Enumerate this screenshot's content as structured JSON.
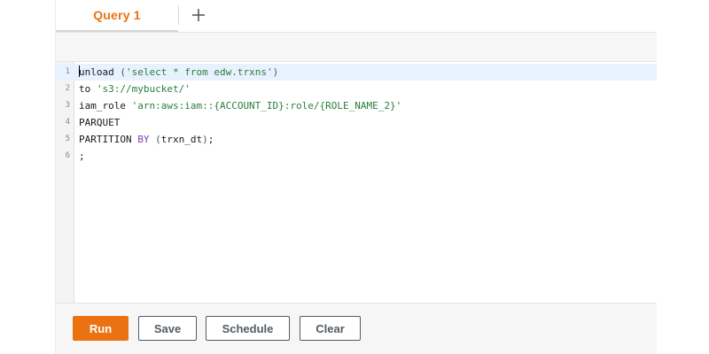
{
  "tabs": {
    "active": "Query 1",
    "add_symbol": "+"
  },
  "editor": {
    "lines": [
      {
        "num": "1",
        "tokens": [
          {
            "t": "unload",
            "c": "plain"
          },
          {
            "t": " ",
            "c": "plain"
          },
          {
            "t": "(",
            "c": "punc"
          },
          {
            "t": "'select * from edw.trxns'",
            "c": "str"
          },
          {
            "t": ")",
            "c": "punc"
          }
        ]
      },
      {
        "num": "2",
        "tokens": [
          {
            "t": "to ",
            "c": "plain"
          },
          {
            "t": "'s3://mybucket/'",
            "c": "str"
          }
        ]
      },
      {
        "num": "3",
        "tokens": [
          {
            "t": "iam_role ",
            "c": "plain"
          },
          {
            "t": "'arn:aws:iam::{ACCOUNT_ID}:role/{ROLE_NAME_2}'",
            "c": "str"
          }
        ]
      },
      {
        "num": "4",
        "tokens": [
          {
            "t": "PARQUET",
            "c": "plain"
          }
        ]
      },
      {
        "num": "5",
        "tokens": [
          {
            "t": "PARTITION ",
            "c": "plain"
          },
          {
            "t": "BY",
            "c": "kw"
          },
          {
            "t": " ",
            "c": "plain"
          },
          {
            "t": "(",
            "c": "punc"
          },
          {
            "t": "trxn_dt",
            "c": "plain"
          },
          {
            "t": ")",
            "c": "punc"
          },
          {
            "t": ";",
            "c": "plain"
          }
        ]
      },
      {
        "num": "6",
        "tokens": [
          {
            "t": ";",
            "c": "plain"
          }
        ]
      }
    ]
  },
  "actions": {
    "run": "Run",
    "save": "Save",
    "schedule": "Schedule",
    "clear": "Clear"
  },
  "colors": {
    "accent": "#ec7211",
    "string": "#2a7d3f",
    "keyword": "#7a3db8",
    "active_line": "#e8f2fe"
  }
}
